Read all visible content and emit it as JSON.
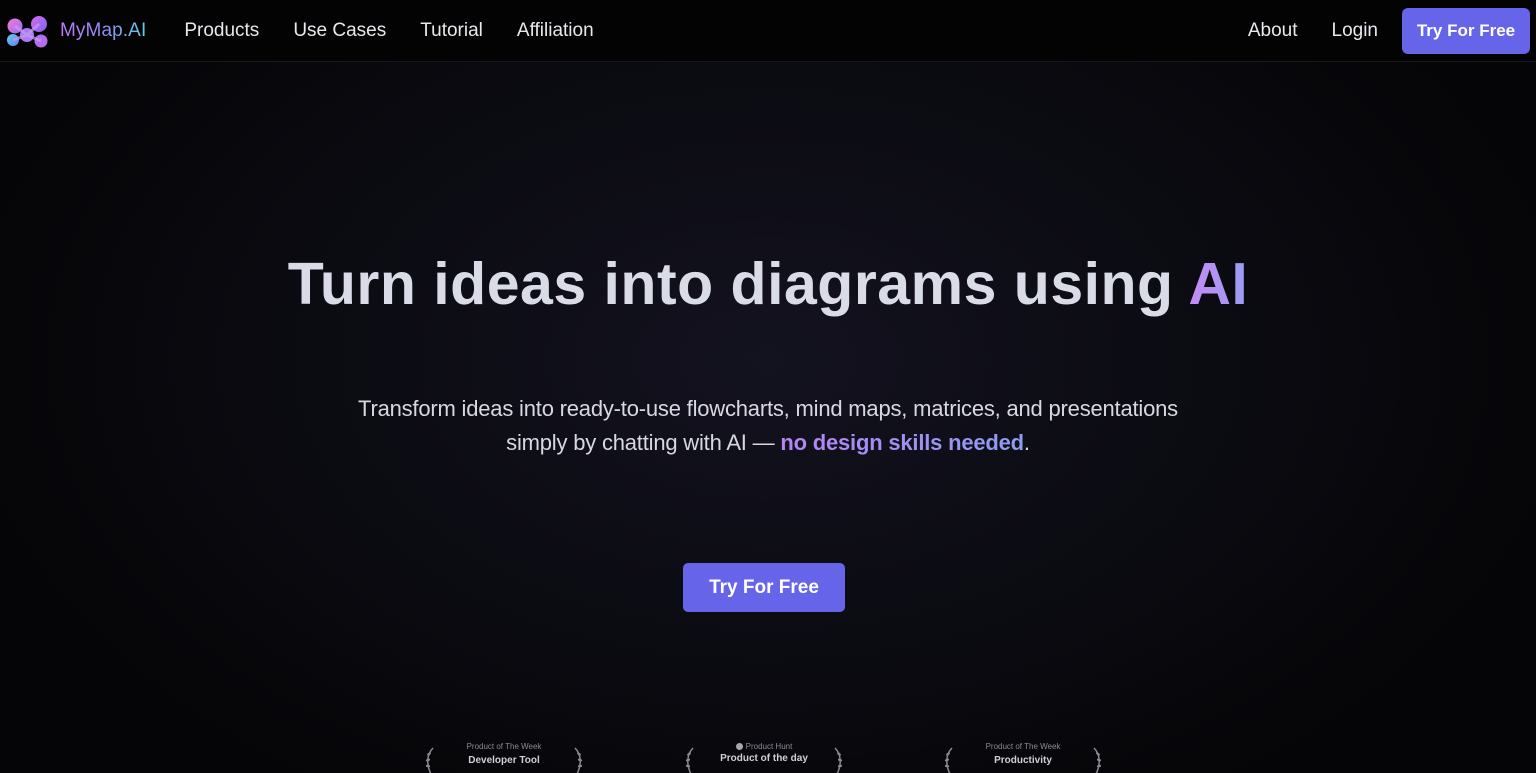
{
  "nav": {
    "brand": "MyMap.AI",
    "links": [
      "Products",
      "Use Cases",
      "Tutorial",
      "Affiliation"
    ],
    "about": "About",
    "login": "Login",
    "cta": "Try For Free"
  },
  "hero": {
    "title_main": "Turn ideas into diagrams using ",
    "title_accent": "AI",
    "subtitle_line1": "Transform ideas into ready-to-use flowcharts, mind maps, matrices, and presentations",
    "subtitle_line2": "simply by chatting with AI — ",
    "subtitle_highlight": "no design skills needed",
    "subtitle_end": ".",
    "cta": "Try For Free"
  },
  "badges": [
    {
      "top": "Product of The Week",
      "main": "Developer Tool"
    },
    {
      "top": "Product Hunt",
      "main": "Product of the day"
    },
    {
      "top": "Product of The Week",
      "main": "Productivity"
    }
  ],
  "colors": {
    "accent": "#6664e8",
    "background": "#050507",
    "gradient_start": "#c58af5",
    "gradient_end": "#8b9df1"
  }
}
